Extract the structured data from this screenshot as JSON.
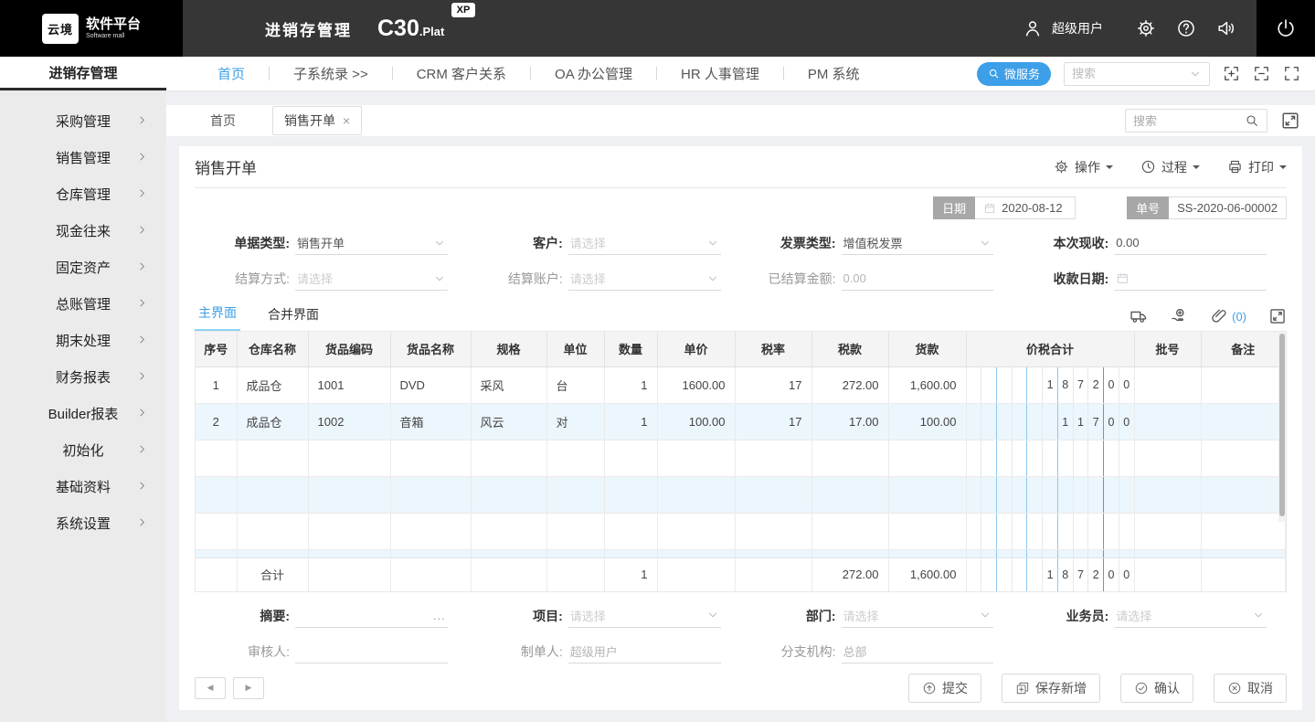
{
  "colors": {
    "accent": "#3d9fe8",
    "tab_underline": "#8fd2f5",
    "alt_row": "#ecf6fd"
  },
  "topbar": {
    "logo_badge": "云境",
    "logo_title": "软件平台",
    "logo_subtitle": "Software mall",
    "app_title": "进销存管理",
    "product_name": "C30",
    "product_suffix": ".Plat",
    "product_badge": "XP",
    "username": "超级用户"
  },
  "navbar": {
    "sidebar_title": "进销存管理",
    "items": [
      {
        "label": "首页",
        "active": true
      },
      {
        "label": "子系统录 >>"
      },
      {
        "label": "CRM 客户关系"
      },
      {
        "label": "OA 办公管理"
      },
      {
        "label": "HR 人事管理"
      },
      {
        "label": "PM 系统"
      }
    ],
    "microservice": "微服务",
    "search_placeholder": "搜索"
  },
  "sidebar": {
    "items": [
      "采购管理",
      "销售管理",
      "仓库管理",
      "现金往来",
      "固定资产",
      "总账管理",
      "期末处理",
      "财务报表",
      "Builder报表",
      "初始化",
      "基础资料",
      "系统设置"
    ]
  },
  "tabstrip": {
    "home_tab": "首页",
    "active_tab": "销售开单",
    "close": "×",
    "search_placeholder": "搜索"
  },
  "page": {
    "title": "销售开单",
    "btn_operate": "操作",
    "btn_process": "过程",
    "btn_print": "打印",
    "date_label": "日期",
    "date_value": "2020-08-12",
    "docno_label": "单号",
    "docno_value": "SS-2020-06-00002"
  },
  "form_top": {
    "doc_type": {
      "label": "单据类型:",
      "value": "销售开单"
    },
    "customer": {
      "label": "客户:",
      "placeholder": "请选择"
    },
    "invoice_type": {
      "label": "发票类型:",
      "value": "增值税发票"
    },
    "cash_received": {
      "label": "本次现收:",
      "value": "0.00"
    },
    "settle_method": {
      "label": "结算方式:",
      "placeholder": "请选择"
    },
    "settle_account": {
      "label": "结算账户:",
      "placeholder": "请选择"
    },
    "settled_amount": {
      "label": "已结算金额:",
      "value": "0.00"
    },
    "receipt_date": {
      "label": "收款日期:"
    }
  },
  "detail": {
    "tab_main": "主界面",
    "tab_merge": "合并界面",
    "attach_count": "(0)"
  },
  "table": {
    "columns": [
      "序号",
      "仓库名称",
      "货品编码",
      "货品名称",
      "规格",
      "单位",
      "数量",
      "单价",
      "税率",
      "税款",
      "货款",
      "价税合计",
      "批号",
      "备注"
    ],
    "rows": [
      {
        "no": "1",
        "warehouse": "成品仓",
        "code": "1001",
        "name": "DVD",
        "spec": "采风",
        "unit": "台",
        "qty": "1",
        "price": "1600.00",
        "tax_rate": "17",
        "tax": "272.00",
        "amount": "1,600.00",
        "total_digits": "187200",
        "batch": "",
        "remark": ""
      },
      {
        "no": "2",
        "warehouse": "成品仓",
        "code": "1002",
        "name": "音箱",
        "spec": "风云",
        "unit": "对",
        "qty": "1",
        "price": "100.00",
        "tax_rate": "17",
        "tax": "17.00",
        "amount": "100.00",
        "total_digits": "11700",
        "batch": "",
        "remark": ""
      }
    ],
    "total_row": {
      "label": "合计",
      "qty": "1",
      "tax": "272.00",
      "amount": "1,600.00",
      "total_digits": "187200"
    }
  },
  "form_bottom": {
    "summary": {
      "label": "摘要:",
      "more": "..."
    },
    "project": {
      "label": "项目:",
      "placeholder": "请选择"
    },
    "department": {
      "label": "部门:",
      "placeholder": "请选择"
    },
    "salesman": {
      "label": "业务员:",
      "placeholder": "请选择"
    },
    "auditor": {
      "label": "审核人:"
    },
    "creator": {
      "label": "制单人:",
      "value": "超级用户"
    },
    "branch": {
      "label": "分支机构:",
      "value": "总部"
    }
  },
  "footer": {
    "submit": "提交",
    "save_new": "保存新增",
    "confirm": "确认",
    "cancel": "取消"
  }
}
